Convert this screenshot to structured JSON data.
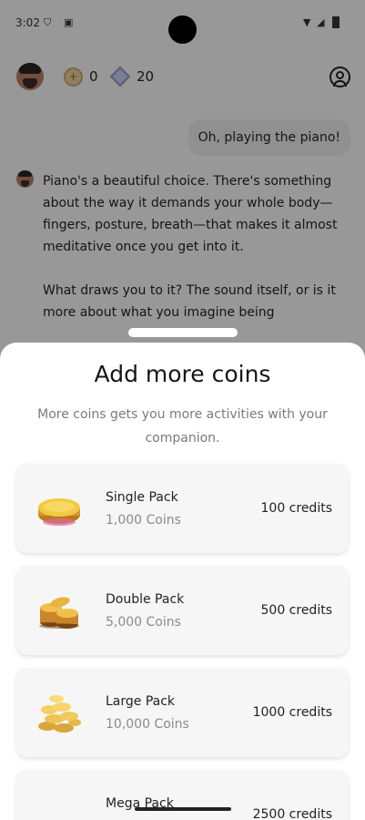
{
  "status_bar": {
    "time": "3:02"
  },
  "header": {
    "coins": "0",
    "gems": "20"
  },
  "chat": {
    "user_message": "Oh, playing the piano!",
    "ai_paragraphs": [
      "Piano's a beautiful choice. There's something about the way it demands your whole body—fingers, posture, breath—that makes it almost meditative once you get into it.",
      "What draws you to it? The sound itself, or is it more about what you imagine being"
    ]
  },
  "sheet": {
    "title": "Add more coins",
    "subtitle": "More coins gets you more activities with your companion.",
    "packs": [
      {
        "name": "Single Pack",
        "coins": "1,000 Coins",
        "price": "100 credits",
        "icon": "single-coin-icon"
      },
      {
        "name": "Double Pack",
        "coins": "5,000 Coins",
        "price": "500 credits",
        "icon": "coin-stack-icon"
      },
      {
        "name": "Large Pack",
        "coins": "10,000 Coins",
        "price": "1000 credits",
        "icon": "coin-pile-icon"
      },
      {
        "name": "Mega Pack",
        "coins": "",
        "price": "2500 credits",
        "icon": "coin-pile-icon"
      }
    ]
  },
  "colors": {
    "gold": "#e2b43a",
    "scrim": "#000000",
    "sheet_bg": "#ffffff",
    "card_bg": "#f6f6f6"
  }
}
